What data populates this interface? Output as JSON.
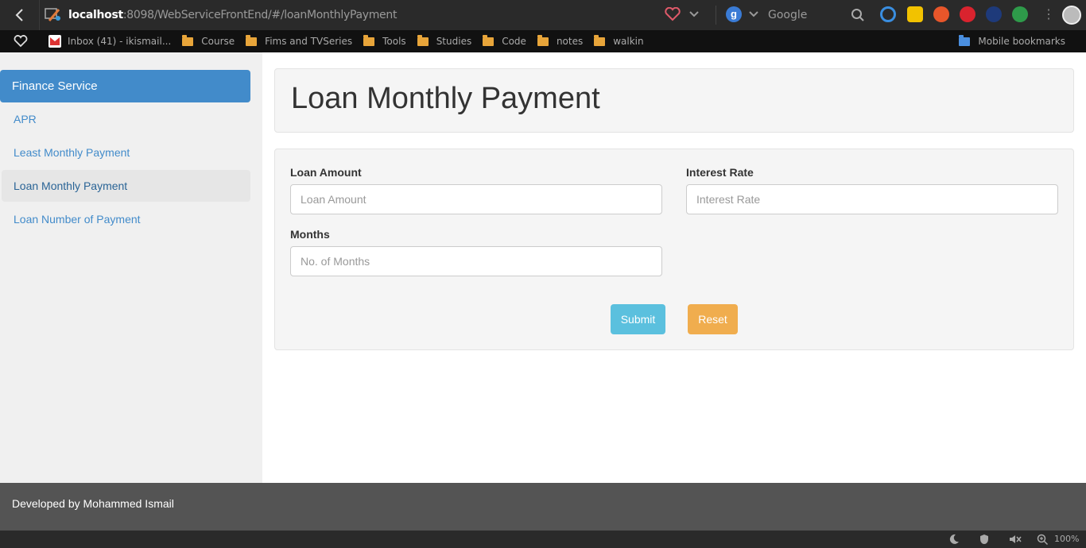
{
  "browser": {
    "url_host": "localhost",
    "url_path": ":8098/WebServiceFrontEnd/#/loanMonthlyPayment",
    "search_placeholder": "Google",
    "search_engine_letter": "g",
    "zoom": "100%"
  },
  "bookmarks": {
    "items": [
      {
        "label": "Inbox (41) - ikismail..."
      },
      {
        "label": "Course"
      },
      {
        "label": "Fims and TVSeries"
      },
      {
        "label": "Tools"
      },
      {
        "label": "Studies"
      },
      {
        "label": "Code"
      },
      {
        "label": "notes"
      },
      {
        "label": "walkin"
      }
    ],
    "mobile": "Mobile bookmarks"
  },
  "sidebar": {
    "header": "Finance Service",
    "items": [
      {
        "label": "APR"
      },
      {
        "label": "Least Monthly Payment"
      },
      {
        "label": "Loan Monthly Payment"
      },
      {
        "label": "Loan Number of Payment"
      }
    ]
  },
  "main": {
    "title": "Loan Monthly Payment",
    "form": {
      "loan_amount_label": "Loan Amount",
      "loan_amount_placeholder": "Loan Amount",
      "interest_rate_label": "Interest Rate",
      "interest_rate_placeholder": "Interest Rate",
      "months_label": "Months",
      "months_placeholder": "No. of Months",
      "submit_label": "Submit",
      "reset_label": "Reset"
    }
  },
  "footer": {
    "text": "Developed by Mohammed Ismail"
  },
  "colors": {
    "primary": "#428bca",
    "info": "#5bc0de",
    "warning": "#f0ad4e",
    "footer": "#545454"
  }
}
